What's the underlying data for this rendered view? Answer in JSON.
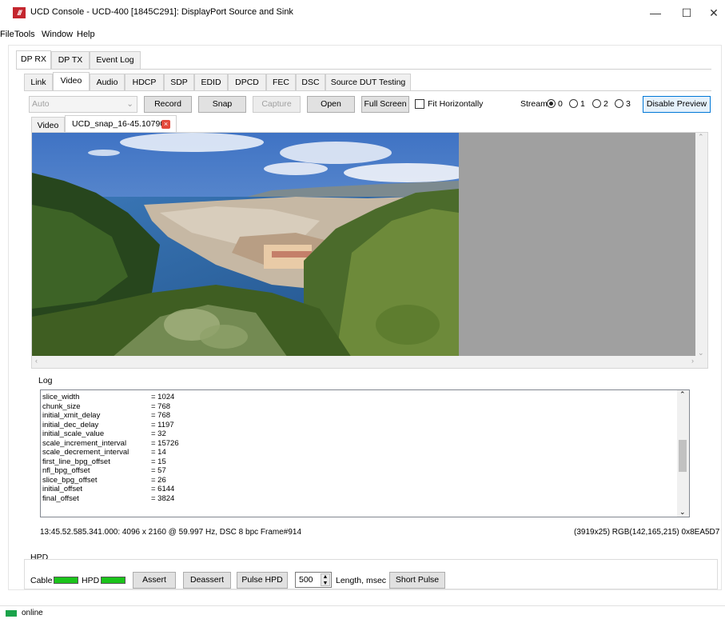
{
  "window": {
    "title": "UCD Console - UCD-400 [1845C291]: DisplayPort Source and Sink",
    "app_icon_text": "///",
    "minimize_glyph": "—",
    "maximize_glyph": "☐",
    "close_glyph": "✕"
  },
  "menu": [
    "File",
    "Tools",
    "Window",
    "Help"
  ],
  "main_tabs": [
    "DP RX",
    "DP TX",
    "Event Log"
  ],
  "sub_tabs": [
    "Link",
    "Video",
    "Audio",
    "HDCP",
    "SDP",
    "EDID",
    "DPCD",
    "FEC",
    "DSC",
    "Source DUT Testing"
  ],
  "toolbar": {
    "mode_value": "Auto",
    "record": "Record",
    "snap": "Snap",
    "capture": "Capture",
    "open": "Open",
    "full_screen": "Full Screen",
    "fit_horizontally": "Fit Horizontally",
    "stream_label": "Stream:",
    "streams": [
      "0",
      "1",
      "2",
      "3"
    ],
    "selected_stream": "0",
    "disable_preview": "Disable Preview"
  },
  "view_tabs": {
    "video": "Video",
    "snapshot": "UCD_snap_16-45.10790"
  },
  "log": {
    "label": "Log",
    "rows": [
      {
        "key": "slice_width",
        "value": "= 1024"
      },
      {
        "key": "chunk_size",
        "value": "= 768"
      },
      {
        "key": "initial_xmit_delay",
        "value": "= 768"
      },
      {
        "key": "initial_dec_delay",
        "value": "= 1197"
      },
      {
        "key": "initial_scale_value",
        "value": "= 32"
      },
      {
        "key": "scale_increment_interval",
        "value": "= 15726"
      },
      {
        "key": "scale_decrement_interval",
        "value": "= 14"
      },
      {
        "key": "first_line_bpg_offset",
        "value": "= 15"
      },
      {
        "key": "nfl_bpg_offset",
        "value": "= 57"
      },
      {
        "key": "slice_bpg_offset",
        "value": "= 26"
      },
      {
        "key": "initial_offset",
        "value": "= 6144"
      },
      {
        "key": "final_offset",
        "value": "= 3824"
      }
    ]
  },
  "status_line": {
    "left": "13:45.52.585.341.000: 4096 x 2160 @ 59.997 Hz, DSC 8 bpc Frame#914",
    "right": "(3919x25) RGB(142,165,215) 0x8EA5D7"
  },
  "hpd": {
    "group_label": "HPD",
    "cable_label": "Cable",
    "hpd_label": "HPD",
    "assert": "Assert",
    "deassert": "Deassert",
    "pulse_hpd": "Pulse HPD",
    "length_value": "500",
    "length_label": "Length, msec",
    "short_pulse": "Short Pulse"
  },
  "statusbar": {
    "text": "online"
  },
  "colors": {
    "led_green": "#1bc41b",
    "accent_border": "#0078d7",
    "close_tab_red": "#e2483a",
    "app_brand_red": "#c4262e"
  }
}
